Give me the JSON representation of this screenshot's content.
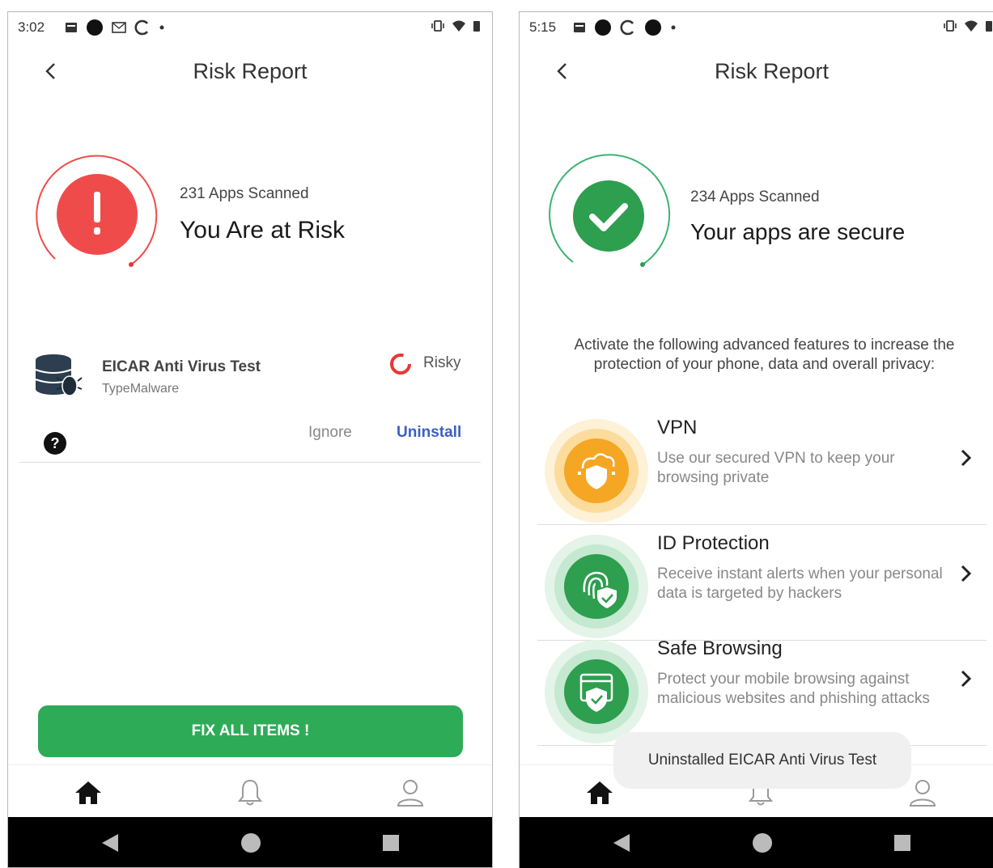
{
  "left_screen": {
    "status_time": "3:02",
    "title": "Risk Report",
    "apps_scanned": "231 Apps Scanned",
    "status_headline": "You Are at Risk",
    "app_item": {
      "name": "EICAR Anti Virus Test",
      "type": "TypeMalware",
      "risk_label": "Risky",
      "ignore_label": "Ignore",
      "uninstall_label": "Uninstall"
    },
    "fix_button": "FIX ALL ITEMS !"
  },
  "right_screen": {
    "status_time": "5:15",
    "title": "Risk Report",
    "apps_scanned": "234 Apps Scanned",
    "status_headline": "Your apps are secure",
    "intro_text": "Activate the following advanced features to increase the protection of your phone, data and overall privacy:",
    "features": [
      {
        "name": "VPN",
        "description": "Use our secured VPN to keep your browsing private",
        "icon": "vpn-cloud-shield-icon",
        "color": "#f5a623"
      },
      {
        "name": "ID Protection",
        "description": "Receive instant alerts when your personal data is targeted by hackers",
        "icon": "fingerprint-shield-icon",
        "color": "#2e9e4f"
      },
      {
        "name": "Safe Browsing",
        "description": "Protect your mobile browsing against malicious websites and phishing attacks",
        "icon": "browser-shield-icon",
        "color": "#2e9e4f"
      }
    ],
    "toast": "Uninstalled EICAR Anti Virus Test"
  },
  "colors": {
    "risk_red": "#f04b4b",
    "secure_green": "#2e9e4f",
    "button_green": "#2eab57",
    "link_blue": "#3b5fc4"
  }
}
